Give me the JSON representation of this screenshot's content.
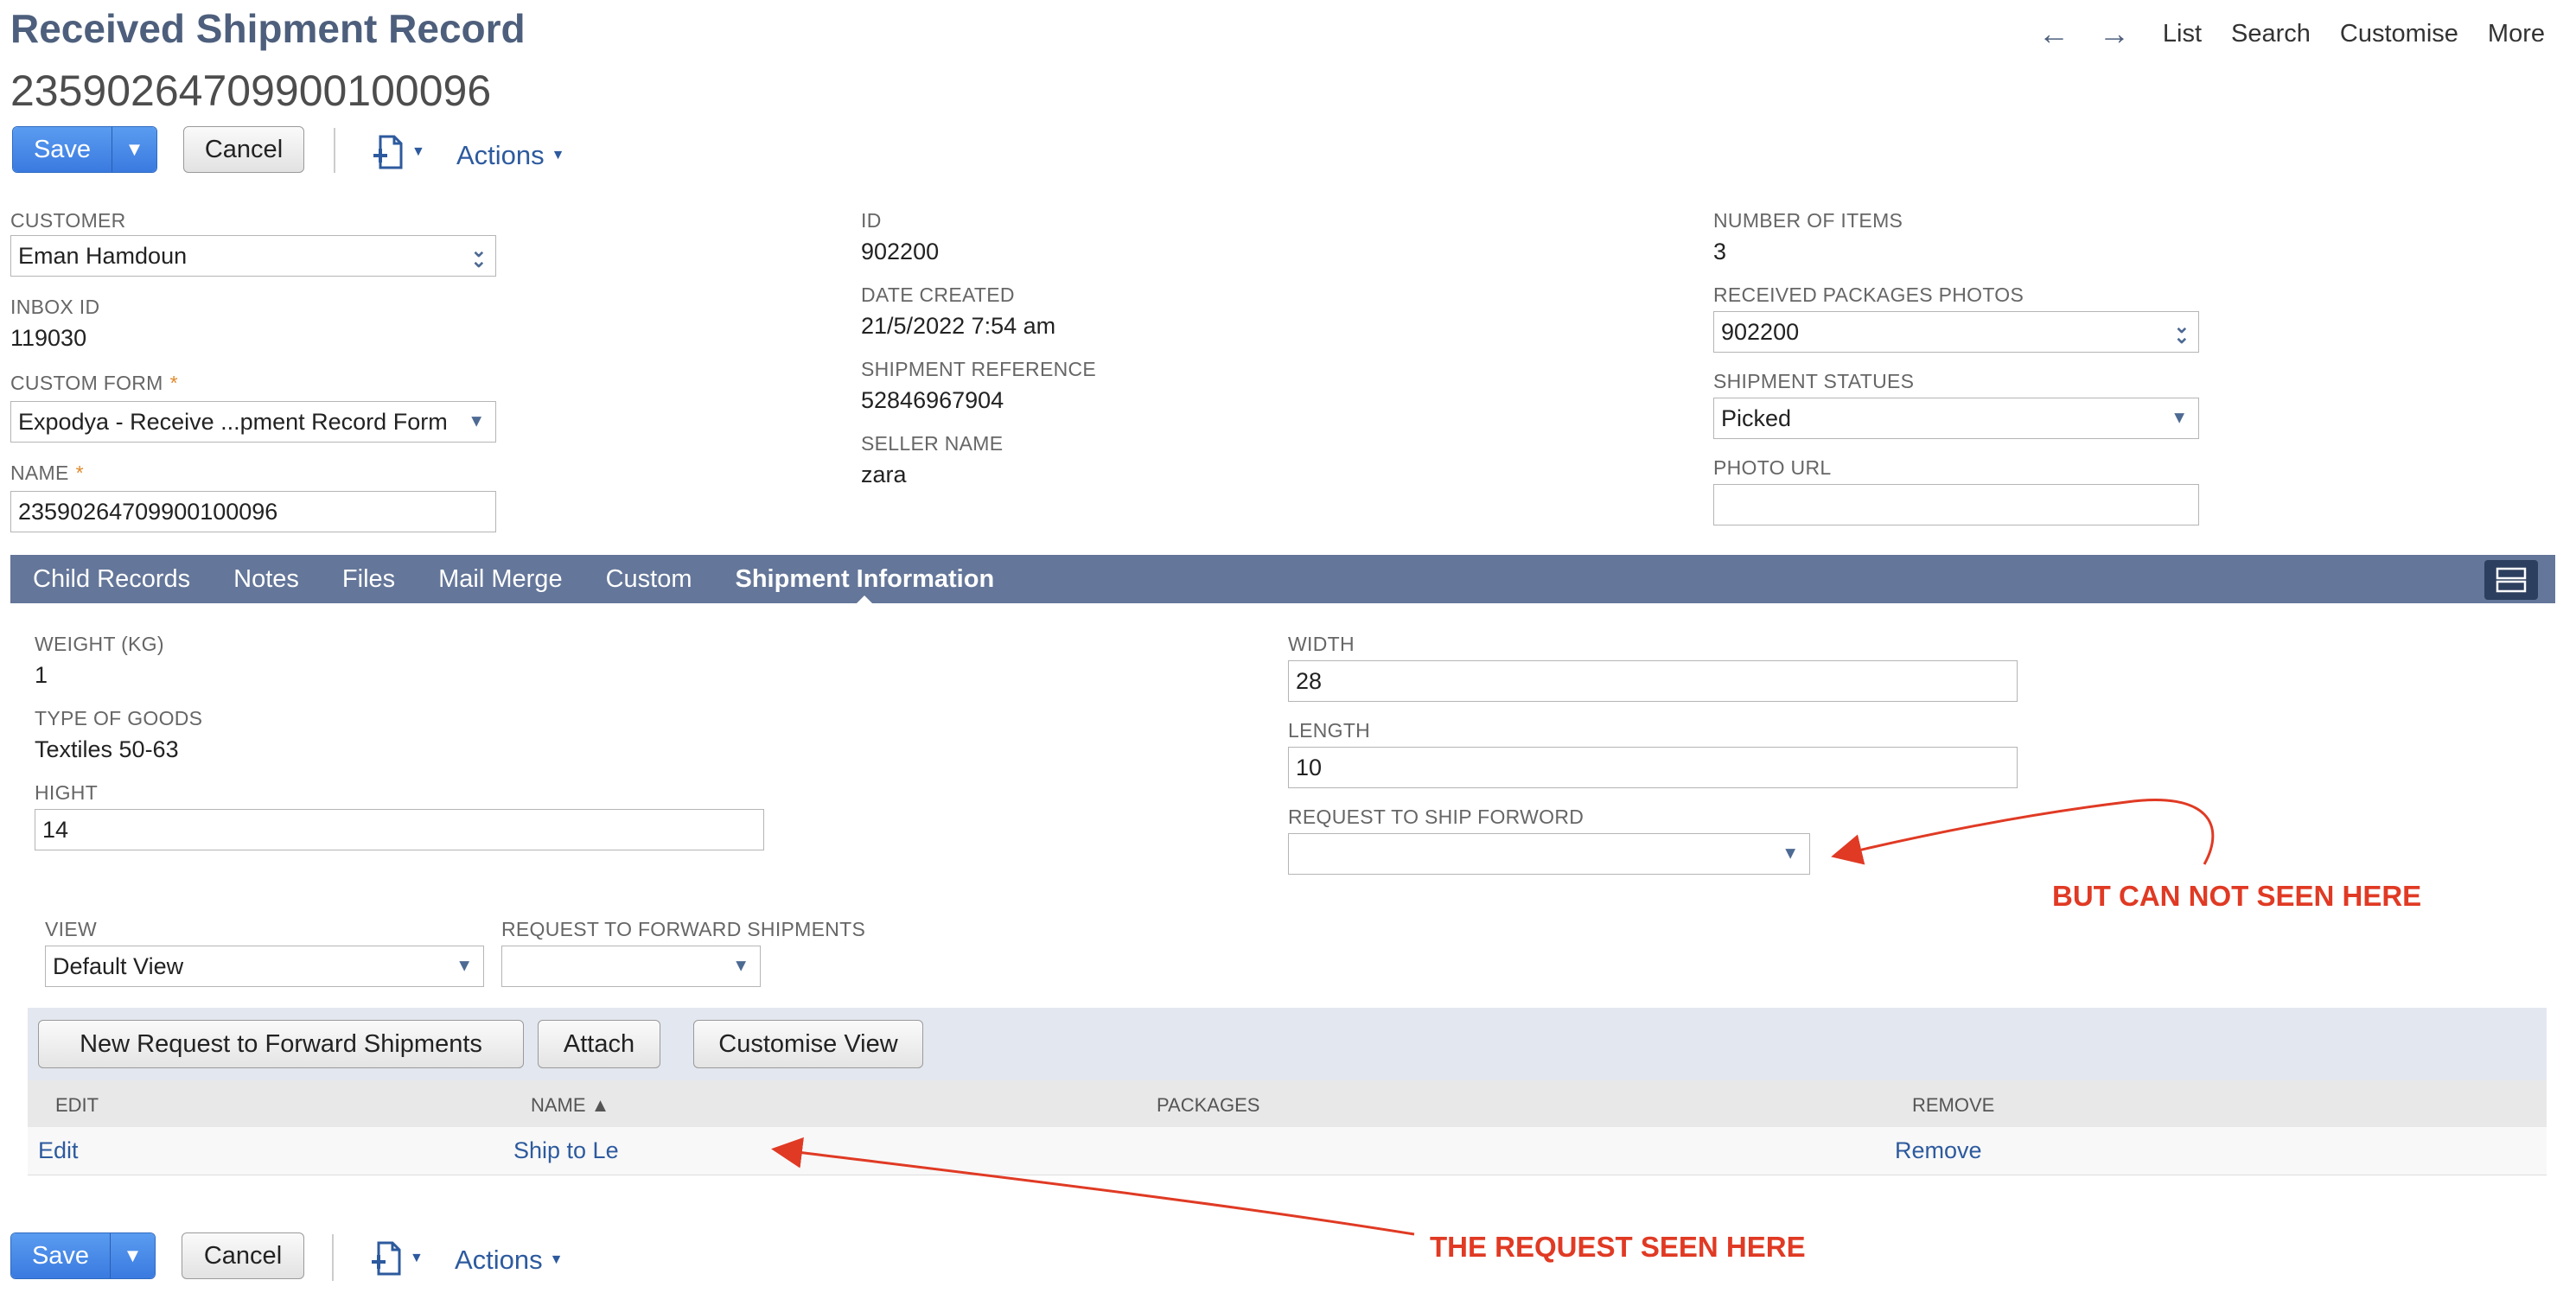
{
  "header": {
    "title": "Received Shipment Record",
    "record_id": "23590264709900100096",
    "nav": {
      "list": "List",
      "search": "Search",
      "customise": "Customise",
      "more": "More"
    }
  },
  "toolbar": {
    "save_label": "Save",
    "cancel_label": "Cancel",
    "actions_label": "Actions"
  },
  "fields": {
    "customer": {
      "label": "CUSTOMER",
      "value": "Eman Hamdoun"
    },
    "inbox_id": {
      "label": "INBOX ID",
      "value": "119030"
    },
    "custom_form": {
      "label": "CUSTOM FORM",
      "value": "Expodya - Receive ...pment Record Form"
    },
    "name": {
      "label": "NAME",
      "value": "23590264709900100096"
    },
    "id": {
      "label": "ID",
      "value": "902200"
    },
    "date_created": {
      "label": "DATE CREATED",
      "value": "21/5/2022 7:54 am"
    },
    "shipment_reference": {
      "label": "SHIPMENT REFERENCE",
      "value": "52846967904"
    },
    "seller_name": {
      "label": "SELLER NAME",
      "value": "zara"
    },
    "number_of_items": {
      "label": "NUMBER OF ITEMS",
      "value": "3"
    },
    "received_packages_photos": {
      "label": "RECEIVED PACKAGES PHOTOS",
      "value": "902200"
    },
    "shipment_statues": {
      "label": "SHIPMENT STATUES",
      "value": "Picked"
    },
    "photo_url": {
      "label": "PHOTO URL",
      "value": ""
    },
    "required_marker": "*"
  },
  "tabs": [
    "Child Records",
    "Notes",
    "Files",
    "Mail Merge",
    "Custom",
    "Shipment Information"
  ],
  "shipment_info": {
    "weight": {
      "label": "WEIGHT (KG)",
      "value": "1"
    },
    "type_of_goods": {
      "label": "TYPE OF GOODS",
      "value": "Textiles 50-63"
    },
    "hight": {
      "label": "HIGHT",
      "value": "14"
    },
    "width": {
      "label": "WIDTH",
      "value": "28"
    },
    "length": {
      "label": "LENGTH",
      "value": "10"
    },
    "request_to_ship_forword": {
      "label": "REQUEST TO SHIP FORWORD",
      "value": ""
    }
  },
  "sublist": {
    "view": {
      "label": "VIEW",
      "value": "Default View"
    },
    "request_to_forward": {
      "label": "REQUEST TO FORWARD SHIPMENTS",
      "value": ""
    },
    "buttons": {
      "new_request": "New Request to Forward Shipments",
      "attach": "Attach",
      "customise_view": "Customise View"
    },
    "columns": {
      "edit": "EDIT",
      "name": "NAME ▲",
      "packages": "PACKAGES",
      "remove": "REMOVE"
    },
    "rows": [
      {
        "edit": "Edit",
        "name": "Ship to Le",
        "packages": "",
        "remove": "Remove"
      }
    ]
  },
  "annotations": {
    "top": "BUT CAN NOT SEEN HERE",
    "bottom": "THE REQUEST SEEN HERE"
  },
  "colors": {
    "annotation": "#e03a24",
    "tabbar": "#647699",
    "link": "#2d5a9e",
    "save": "#3a7ae0"
  }
}
